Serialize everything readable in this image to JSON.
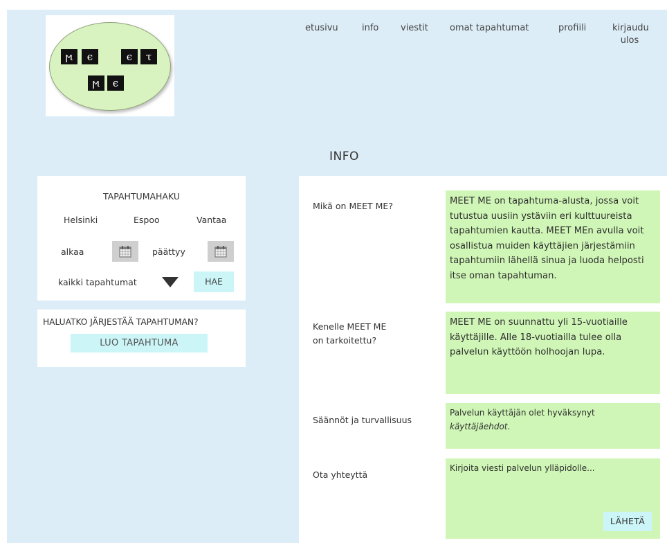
{
  "logo": {
    "letters_row1": [
      "ϻ",
      "ϵ",
      "ϵ",
      "τ"
    ],
    "letters_row2": [
      "ϻ",
      "ϵ"
    ]
  },
  "nav": {
    "etusivu": "etusivu",
    "info": "info",
    "viestit": "viestit",
    "omat_tapahtumat": "omat tapahtumat",
    "profiili": "profiili",
    "kirjaudu_line1": "kirjaudu",
    "kirjaudu_line2": "ulos"
  },
  "page_title": "INFO",
  "search": {
    "title": "TAPAHTUMAHAKU",
    "cities": [
      "Helsinki",
      "Espoo",
      "Vantaa"
    ],
    "start_label": "alkaa",
    "end_label": "päättyy",
    "category_value": "kaikki tapahtumat",
    "search_button": "HAE",
    "icons": [
      "calendar-icon",
      "calendar-icon",
      "dropdown-arrow-icon"
    ]
  },
  "create": {
    "question": "HALUATKO JÄRJESTÄÄ TAPAHTUMAN?",
    "button": "LUO TAPAHTUMA"
  },
  "info": {
    "q1": "Mikä on MEET ME?",
    "a1": "MEET ME on tapahtuma-alusta, jossa voit tutustua uusiin ystäviin eri kulttuureista tapahtumien kautta. MEET MEn avulla voit osallistua muiden käyttäjien järjestämiin tapahtumiin lähellä sinua ja luoda helposti itse oman tapahtuman.",
    "q2_line1": "Kenelle MEET ME",
    "q2_line2": "on tarkoitettu?",
    "a2": "MEET ME on suunnattu yli 15-vuotiaille käyttäjille. Alle 18-vuotiailla tulee olla palvelun käyttöön holhoojan lupa.",
    "q3": "Säännöt ja turvallisuus",
    "a3_prefix": "Palvelun käyttäjän olet hyväksynyt",
    "a3_link": "käyttäjäehdot",
    "a3_suffix": ".",
    "q4": "Ota yhteyttä",
    "message_placeholder": "Kirjoita viesti palvelun ylläpidolle...",
    "send_button": "LÄHETÄ"
  },
  "colors": {
    "background": "#dcedf7",
    "answer_box": "#cff6b6",
    "button": "#ccf5f7",
    "logo_oval": "#d8f3c0"
  }
}
